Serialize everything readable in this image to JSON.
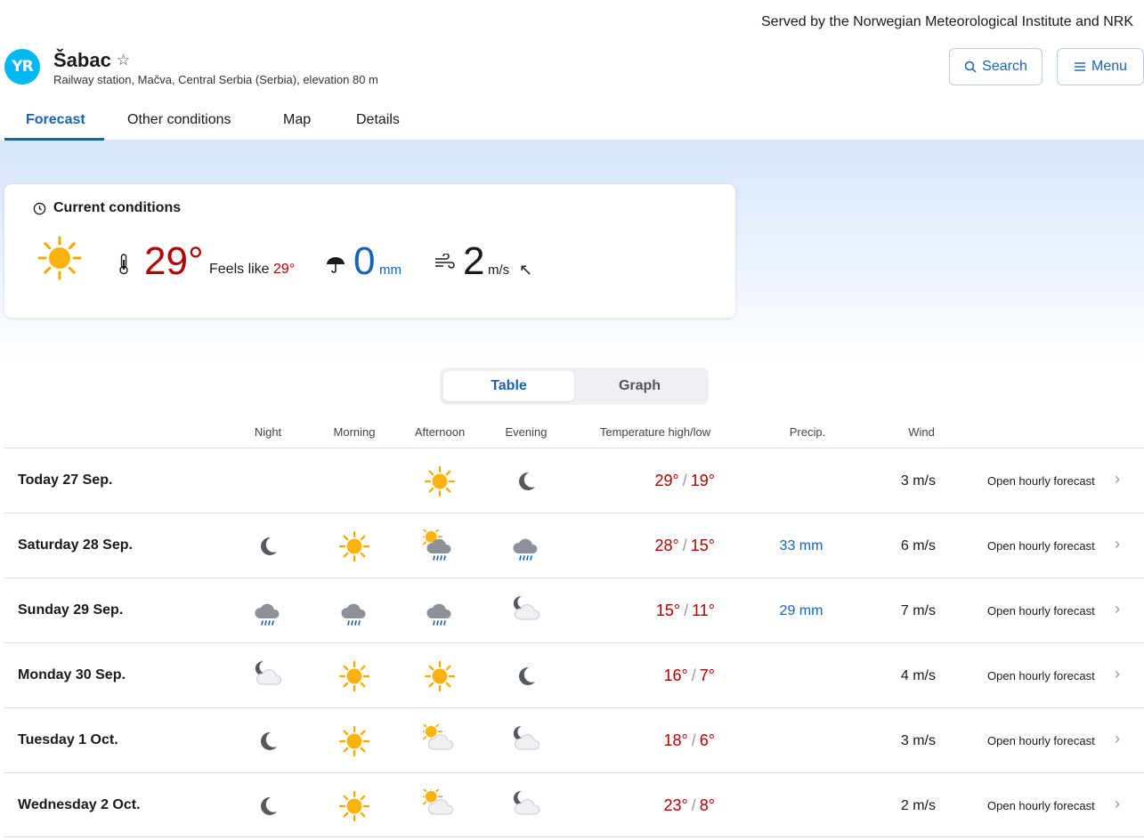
{
  "header": {
    "served_by": "Served by the Norwegian Meteorological Institute and NRK",
    "logo_text": "YR",
    "location_name": "Šabac",
    "location_sub": "Railway station, Mačva, Central Serbia (Serbia), elevation 80 m",
    "search_label": "Search",
    "menu_label": "Menu"
  },
  "tabs": [
    "Forecast",
    "Other conditions",
    "Map",
    "Details"
  ],
  "current": {
    "title": "Current conditions",
    "icon": "sun-icon",
    "temperature": "29°",
    "feels_like_label": "Feels like",
    "feels_like_value": "29°",
    "precip_value": "0",
    "precip_unit": "mm",
    "wind_value": "2",
    "wind_unit": "m/s",
    "wind_direction": "↖"
  },
  "view_toggle": {
    "table": "Table",
    "graph": "Graph"
  },
  "columns": {
    "night": "Night",
    "morning": "Morning",
    "afternoon": "Afternoon",
    "evening": "Evening",
    "temp": "Temperature high/low",
    "precip": "Precip.",
    "wind": "Wind"
  },
  "rows": [
    {
      "day": "Today 27 Sep.",
      "icons": [
        "",
        "",
        "sun",
        "moon"
      ],
      "high": "29°",
      "low": "19°",
      "precip": "",
      "wind": "3 m/s",
      "link": "Open hourly forecast"
    },
    {
      "day": "Saturday 28 Sep.",
      "icons": [
        "moon",
        "sun",
        "sun-cloud-rain",
        "cloud-rain"
      ],
      "high": "28°",
      "low": "15°",
      "precip": "33 mm",
      "wind": "6 m/s",
      "link": "Open hourly forecast"
    },
    {
      "day": "Sunday 29 Sep.",
      "icons": [
        "cloud-rain",
        "cloud-rain",
        "cloud-rain",
        "moon-cloud"
      ],
      "high": "15°",
      "low": "11°",
      "precip": "29 mm",
      "wind": "7 m/s",
      "link": "Open hourly forecast"
    },
    {
      "day": "Monday 30 Sep.",
      "icons": [
        "moon-cloud",
        "sun",
        "sun",
        "moon"
      ],
      "high": "16°",
      "low": "7°",
      "precip": "",
      "wind": "4 m/s",
      "link": "Open hourly forecast"
    },
    {
      "day": "Tuesday 1 Oct.",
      "icons": [
        "moon",
        "sun",
        "sun-cloud",
        "moon-cloud"
      ],
      "high": "18°",
      "low": "6°",
      "precip": "",
      "wind": "3 m/s",
      "link": "Open hourly forecast"
    },
    {
      "day": "Wednesday 2 Oct.",
      "icons": [
        "moon",
        "sun",
        "sun-cloud",
        "moon-cloud"
      ],
      "high": "23°",
      "low": "8°",
      "precip": "",
      "wind": "2 m/s",
      "link": "Open hourly forecast"
    }
  ],
  "colors": {
    "accent": "#1763b5",
    "temp": "#b30000",
    "logo": "#00b8f1"
  }
}
